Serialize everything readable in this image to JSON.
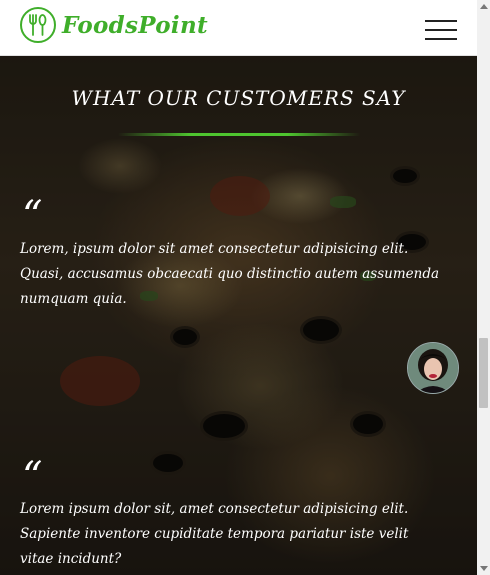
{
  "header": {
    "logo_text": "FoodsPoint"
  },
  "testimonials": {
    "title": "WHAT OUR CUSTOMERS SAY",
    "quote_mark": "“",
    "items": [
      {
        "text": "Lorem, ipsum dolor sit amet consectetur adipisicing elit. Quasi, accusamus obcaecati quo distinctio autem assumenda numquam quia."
      },
      {
        "text": "Lorem ipsum dolor sit, amet consectetur adipisicing elit. Sapiente inventore cupiditate tempora pariatur iste velit vitae incidunt?"
      }
    ]
  },
  "colors": {
    "brand_green": "#3fae2a",
    "accent_line": "#4ec52f"
  },
  "icons": [
    "fork-spoon-logo-icon",
    "hamburger-menu-icon"
  ]
}
